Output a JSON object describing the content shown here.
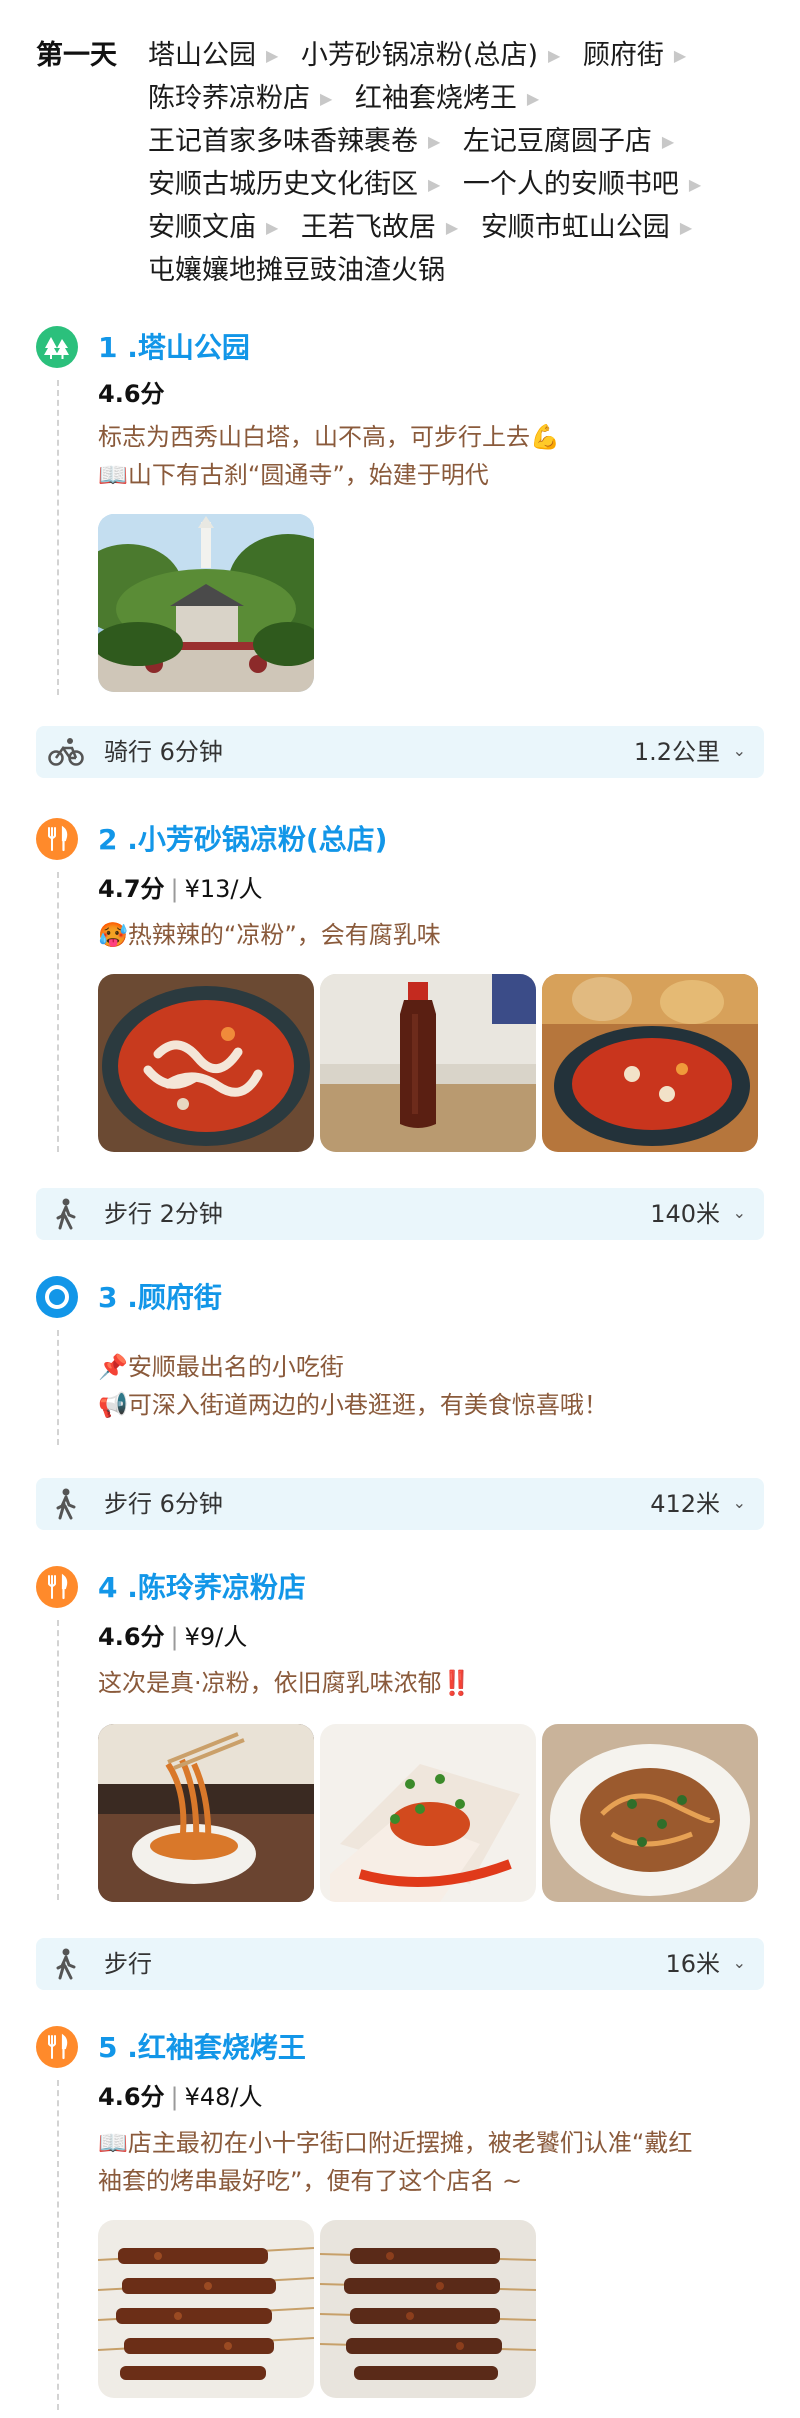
{
  "day": {
    "label": "第一天",
    "route": [
      "塔山公园",
      "小芳砂锅凉粉(总店)",
      "顾府街",
      "陈玲荞凉粉店",
      "红袖套烧烤王",
      "王记首家多味香辣裹卷",
      "左记豆腐圆子店",
      "安顺古城历史文化街区",
      "一个人的安顺书吧",
      "安顺文庙",
      "王若飞故居",
      "安顺市虹山公园",
      "屯孃孃地摊豆豉油渣火锅"
    ]
  },
  "stops": [
    {
      "index": "1",
      "title": "1 .塔山公园",
      "icon": "tree-icon",
      "rating": "4.6分",
      "price": "",
      "desc": [
        "标志为西秀山白塔，山不高，可步行上去💪",
        "📖山下有古刹“圆通寺”，始建于明代"
      ]
    },
    {
      "index": "2",
      "title": "2 .小芳砂锅凉粉(总店)",
      "icon": "fork-knife-icon",
      "rating": "4.7分",
      "price": "¥13/人",
      "desc": [
        "🥵热辣辣的“凉粉”，会有腐乳味"
      ]
    },
    {
      "index": "3",
      "title": "3 .顾府街",
      "icon": "location-dot-icon",
      "rating": "",
      "price": "",
      "desc": [
        "📌安顺最出名的小吃街",
        "📢可深入街道两边的小巷逛逛，有美食惊喜哦！"
      ]
    },
    {
      "index": "4",
      "title": "4 .陈玲荞凉粉店",
      "icon": "fork-knife-icon",
      "rating": "4.6分",
      "price": "¥9/人",
      "desc": [
        "这次是真·凉粉，依旧腐乳味浓郁‼️"
      ]
    },
    {
      "index": "5",
      "title": "5 .红袖套烧烤王",
      "icon": "fork-knife-icon",
      "rating": "4.6分",
      "price": "¥48/人",
      "desc": [
        "📖店主最初在小十字街口附近摆摊，被老饕们认准“戴红",
        "袖套的烤串最好吃”，便有了这个店名 ~"
      ]
    }
  ],
  "transit": [
    {
      "mode": "骑行 6分钟",
      "distance": "1.2公里",
      "icon": "bicycle-icon"
    },
    {
      "mode": "步行 2分钟",
      "distance": "140米",
      "icon": "walking-person-icon"
    },
    {
      "mode": "步行 6分钟",
      "distance": "412米",
      "icon": "walking-person-icon"
    },
    {
      "mode": "步行",
      "distance": "16米",
      "icon": "walking-person-icon"
    }
  ],
  "photos": {
    "tashan": [
      "white-pagoda-temple-photo"
    ],
    "xiaofang": [
      "clay-pot-liangfen-photo",
      "sauce-bottle-photo",
      "spicy-pot-dish-photo"
    ],
    "chenling": [
      "noodle-chopsticks-photo",
      "liangfen-sheets-photo",
      "liangfen-salad-photo"
    ],
    "hongxiutao": [
      "bbq-skewers-photo-1",
      "bbq-skewers-photo-2"
    ]
  },
  "colors": {
    "accent_blue": "#1296e8",
    "accent_orange": "#ff8a2b",
    "accent_green": "#2bc07c",
    "desc_brown": "#8a5a3b",
    "transit_bg": "#eaf6fb"
  }
}
